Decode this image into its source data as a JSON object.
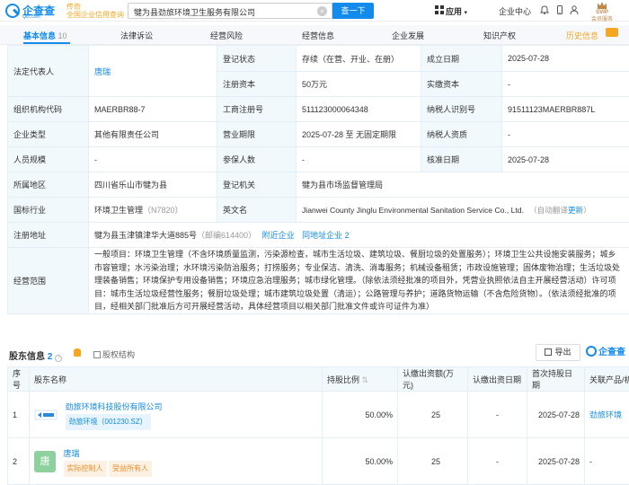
{
  "header": {
    "logo_name": "企查查",
    "logo_domain": "Qcc.com",
    "slogan_line1": "传奇",
    "slogan_line2": "全国企业信用查询",
    "search_value": "犍为县劲旅环境卫生服务有限公司",
    "search_button": "查一下",
    "nav_app": "应用",
    "nav_enterprise": "企业中心",
    "vip_line1": "SVIP",
    "vip_line2": "会员服务"
  },
  "tabs": [
    {
      "label": "基本信息",
      "count": "10"
    },
    {
      "label": "法律诉讼"
    },
    {
      "label": "经营风险"
    },
    {
      "label": "经营信息"
    },
    {
      "label": "企业发展"
    },
    {
      "label": "知识产权"
    },
    {
      "label": "历史信息"
    }
  ],
  "info": {
    "legal_rep_label": "法定代表人",
    "legal_rep_value": "唐瑞",
    "reg_status_label": "登记状态",
    "reg_status_value": "存续（在营、开业、在册）",
    "est_date_label": "成立日期",
    "est_date_value": "2025-07-28",
    "reg_capital_label": "注册资本",
    "reg_capital_value": "50万元",
    "paid_capital_label": "实缴资本",
    "paid_capital_value": "-",
    "org_code_label": "组织机构代码",
    "org_code_value": "MAERBR88-7",
    "biz_reg_label": "工商注册号",
    "biz_reg_value": "511123000064348",
    "taxpayer_id_label": "纳税人识别号",
    "taxpayer_id_value": "91511123MAERBR887L",
    "company_type_label": "企业类型",
    "company_type_value": "其他有限责任公司",
    "biz_term_label": "营业期限",
    "biz_term_value": "2025-07-28 至 无固定期限",
    "taxpayer_qual_label": "纳税人资质",
    "taxpayer_qual_value": "-",
    "staff_size_label": "人员规模",
    "staff_size_value": "-",
    "insured_label": "参保人数",
    "insured_value": "-",
    "approval_date_label": "核准日期",
    "approval_date_value": "2025-07-28",
    "region_label": "所属地区",
    "region_value": "四川省乐山市犍为县",
    "authority_label": "登记机关",
    "authority_value": "犍为县市场监督管理局",
    "industry_label": "国标行业",
    "industry_value": "环境卫生管理",
    "industry_code": "（N7820）",
    "english_label": "英文名",
    "english_value": "Jianwei County Jinglu Environmental Sanitation Service Co., Ltd.",
    "english_note": "（自动翻译",
    "english_more": "更新",
    "english_close": "）",
    "address_label": "注册地址",
    "address_value": "犍为县玉津镇津华大道885号",
    "postcode": "（邮编614400）",
    "nearby": "附近企业",
    "same_address": "同地址企业 2",
    "scope_label": "经营范围",
    "scope_value": "一般项目：环境卫生管理（不含环境质量监测，污染源检查，城市生活垃圾、建筑垃圾、餐厨垃圾的处置服务）；环境卫生公共设施安装服务；城乡市容管理；水污染治理；水环境污染防治服务；打捞服务；专业保洁、清洗、消毒服务；机械设备租赁；市政设施管理；固体废物治理；生活垃圾处理装备销售；环境保护专用设备销售；环境应急治理服务；城市绿化管理。（除依法须经批准的项目外，凭营业执照依法自主开展经营活动）许可项目：城市生活垃圾经营性服务；餐厨垃圾处理；城市建筑垃圾处置（清运）；公路管理与养护；道路货物运输（不含危险货物）。（依法须经批准的项目，经相关部门批准后方可开展经营活动，具体经营项目以相关部门批准文件或许可证件为准）"
  },
  "shareholders": {
    "title": "股东信息",
    "count": "2",
    "help": "?",
    "equity_tab": "股权结构",
    "export": "导出",
    "brand": "企查查",
    "columns": [
      "序号",
      "股东名称",
      "持股比例",
      "认缴出资额(万元)",
      "认缴出资日期",
      "首次持股日期",
      "关联产品/机构"
    ],
    "rows": [
      {
        "no": "1",
        "name": "劲旅环境科技股份有限公司",
        "tag": "劲旅环境（001230.SZ）",
        "ratio": "50.00%",
        "amount": "25",
        "date": "-",
        "first_date": "2025-07-28",
        "product": "劲旅环境"
      },
      {
        "no": "2",
        "name": "唐瑞",
        "avatar": "唐",
        "tag": "实际控制人",
        "tag2": "受益所有人",
        "ratio": "50.00%",
        "amount": "25",
        "date": "-",
        "first_date": "2025-07-28",
        "product": "-"
      }
    ]
  },
  "colors": {
    "accent": "#128bed",
    "header_bg": "#f2f9fc",
    "border": "#e4eef6",
    "orange": "#f08a24"
  }
}
